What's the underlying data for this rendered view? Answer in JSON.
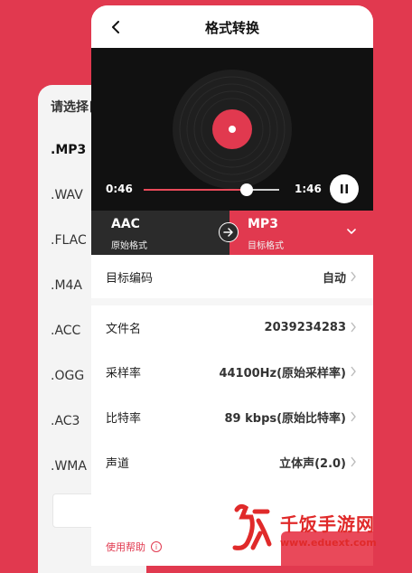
{
  "list_panel": {
    "title": "请选择目",
    "items": [
      ".MP3",
      ".WAV",
      ".FLAC",
      ".M4A",
      ".ACC",
      ".OGG",
      ".AC3",
      ".WMA"
    ],
    "selected_index": 0
  },
  "header": {
    "title": "格式转换",
    "back_icon": "chevron-left-icon"
  },
  "player": {
    "current_time": "0:46",
    "total_time": "1:46",
    "progress": 0.76,
    "accent_color": "#e94a5a"
  },
  "format_bar": {
    "source_format": "AAC",
    "source_label": "原始格式",
    "target_format": "MP3",
    "target_label": "目标格式"
  },
  "settings": [
    {
      "label": "目标编码",
      "value": "自动"
    },
    {
      "label": "文件名",
      "value": "2039234283"
    },
    {
      "label": "采样率",
      "value": "44100Hz(原始采样率)"
    },
    {
      "label": "比特率",
      "value": "89 kbps(原始比特率)"
    },
    {
      "label": "声道",
      "value": "立体声(2.0)"
    }
  ],
  "help": {
    "label": "使用帮助",
    "icon": "info-icon"
  },
  "watermark": {
    "text": "千饭手游网",
    "url": "www.eduext.com"
  },
  "colors": {
    "brand": "#e1394f",
    "dark": "#2b2b2b"
  }
}
